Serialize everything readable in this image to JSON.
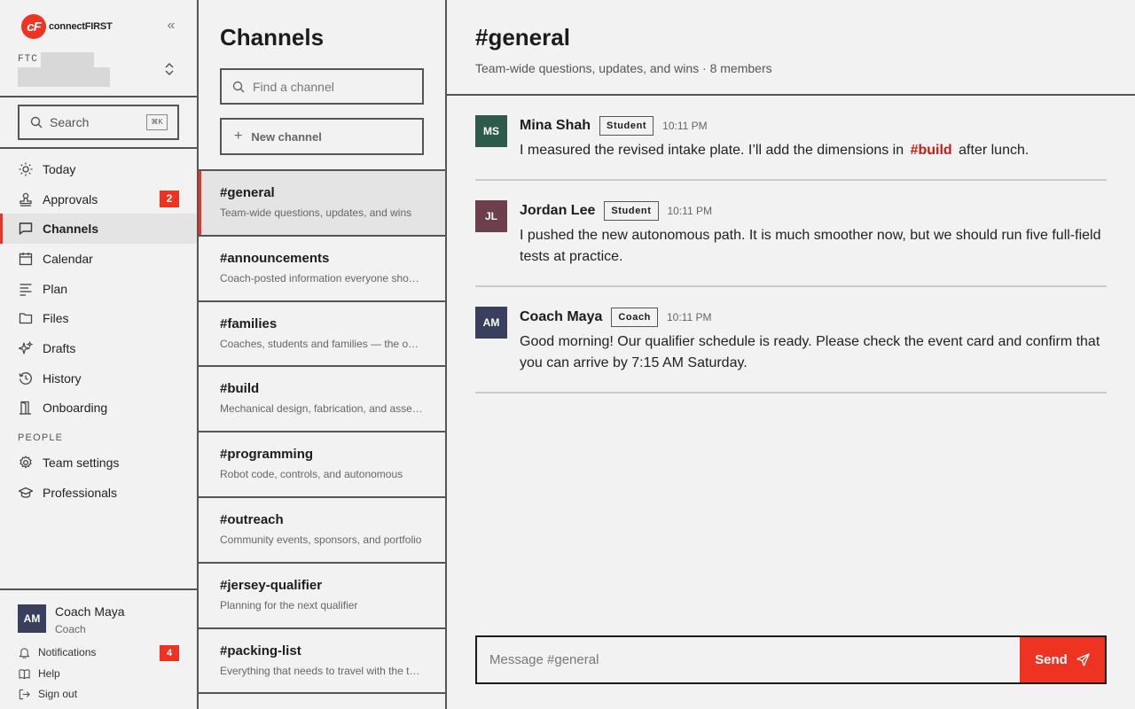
{
  "brand": {
    "mark": "cF",
    "name": "connectFIRST"
  },
  "team": {
    "label": "FTC"
  },
  "sidebar_search": {
    "label": "Search",
    "shortcut": "⌘K"
  },
  "nav": [
    {
      "label": "Today",
      "icon": "sun-icon"
    },
    {
      "label": "Approvals",
      "icon": "stamp-icon",
      "badge": "2"
    },
    {
      "label": "Channels",
      "icon": "chat-bubble-icon",
      "active": true
    },
    {
      "label": "Calendar",
      "icon": "calendar-icon"
    },
    {
      "label": "Plan",
      "icon": "list-icon"
    },
    {
      "label": "Files",
      "icon": "folder-icon"
    },
    {
      "label": "Drafts",
      "icon": "sparkle-icon"
    },
    {
      "label": "History",
      "icon": "history-icon"
    },
    {
      "label": "Onboarding",
      "icon": "door-icon"
    }
  ],
  "people_section": "PEOPLE",
  "people_nav": [
    {
      "label": "Team settings",
      "icon": "gear-icon"
    },
    {
      "label": "Professionals",
      "icon": "graduation-cap-icon"
    }
  ],
  "user": {
    "initials": "AM",
    "name": "Coach Maya",
    "role": "Coach",
    "notifications_label": "Notifications",
    "notifications_badge": "4",
    "help_label": "Help",
    "signout_label": "Sign out"
  },
  "channels": {
    "title": "Channels",
    "find_placeholder": "Find a channel",
    "new_channel_label": "New channel",
    "items": [
      {
        "name": "#general",
        "desc": "Team-wide questions, updates, and wins",
        "active": true
      },
      {
        "name": "#announcements",
        "desc": "Coach-posted information everyone should see"
      },
      {
        "name": "#families",
        "desc": "Coaches, students and families — the one place for logistics"
      },
      {
        "name": "#build",
        "desc": "Mechanical design, fabrication, and assembly"
      },
      {
        "name": "#programming",
        "desc": "Robot code, controls, and autonomous"
      },
      {
        "name": "#outreach",
        "desc": "Community events, sponsors, and portfolio"
      },
      {
        "name": "#jersey-qualifier",
        "desc": "Planning for the next qualifier"
      },
      {
        "name": "#packing-list",
        "desc": "Everything that needs to travel with the team"
      }
    ]
  },
  "main": {
    "title": "#general",
    "subtitle": "Team-wide questions, updates, and wins · 8 members",
    "messages": [
      {
        "initials": "MS",
        "avatar_color": "#2d5a4a",
        "author": "Mina Shah",
        "role": "Student",
        "time": "10:11 PM",
        "body_before": "I measured the revised intake plate. I’ll add the dimensions in",
        "mention": "#build",
        "body_after": "after lunch."
      },
      {
        "initials": "JL",
        "avatar_color": "#6b3f4c",
        "author": "Jordan Lee",
        "role": "Student",
        "time": "10:11 PM",
        "body": "I pushed the new autonomous path. It is much smoother now, but we should run five full-field tests at practice."
      },
      {
        "initials": "AM",
        "avatar_color": "#3a3f5c",
        "author": "Coach Maya",
        "role": "Coach",
        "time": "10:11 PM",
        "body": "Good morning! Our qualifier schedule is ready. Please check the event card and confirm that you can arrive by 7:15 AM Saturday."
      }
    ],
    "composer_placeholder": "Message #general",
    "send_label": "Send"
  },
  "colors": {
    "accent": "#ee3322",
    "mention": "#c21f12"
  }
}
